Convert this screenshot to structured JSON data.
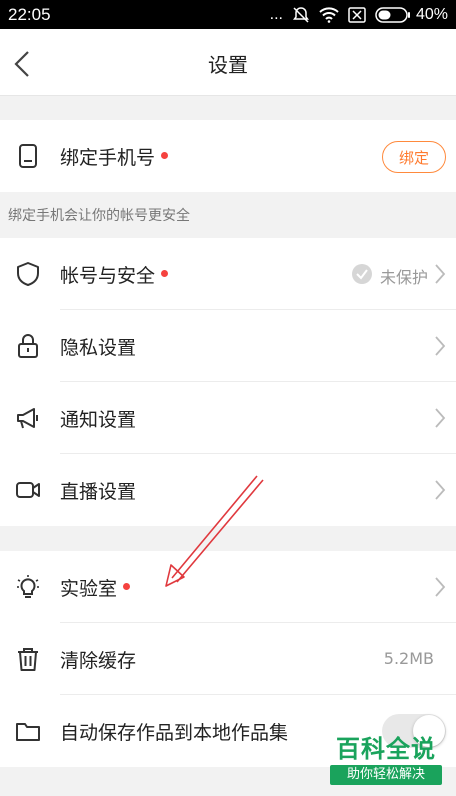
{
  "status_bar": {
    "time": "22:05",
    "dots": "...",
    "battery": "40%"
  },
  "header": {
    "title": "设置"
  },
  "phone": {
    "label": "绑定手机号",
    "bind_button": "绑定",
    "hint": "绑定手机会让你的帐号更安全"
  },
  "items": [
    {
      "label": "帐号与安全",
      "status": "未保护"
    },
    {
      "label": "隐私设置"
    },
    {
      "label": "通知设置"
    },
    {
      "label": "直播设置"
    }
  ],
  "items2": [
    {
      "label": "实验室"
    },
    {
      "label": "清除缓存",
      "value": "5.2MB"
    },
    {
      "label": "自动保存作品到本地作品集"
    }
  ],
  "watermark": {
    "top": "百科全说",
    "bottom": "助你轻松解决"
  },
  "colors": {
    "accent": "#ff7a2e",
    "dot": "#f5423f",
    "watermark": "#1aa35c"
  }
}
